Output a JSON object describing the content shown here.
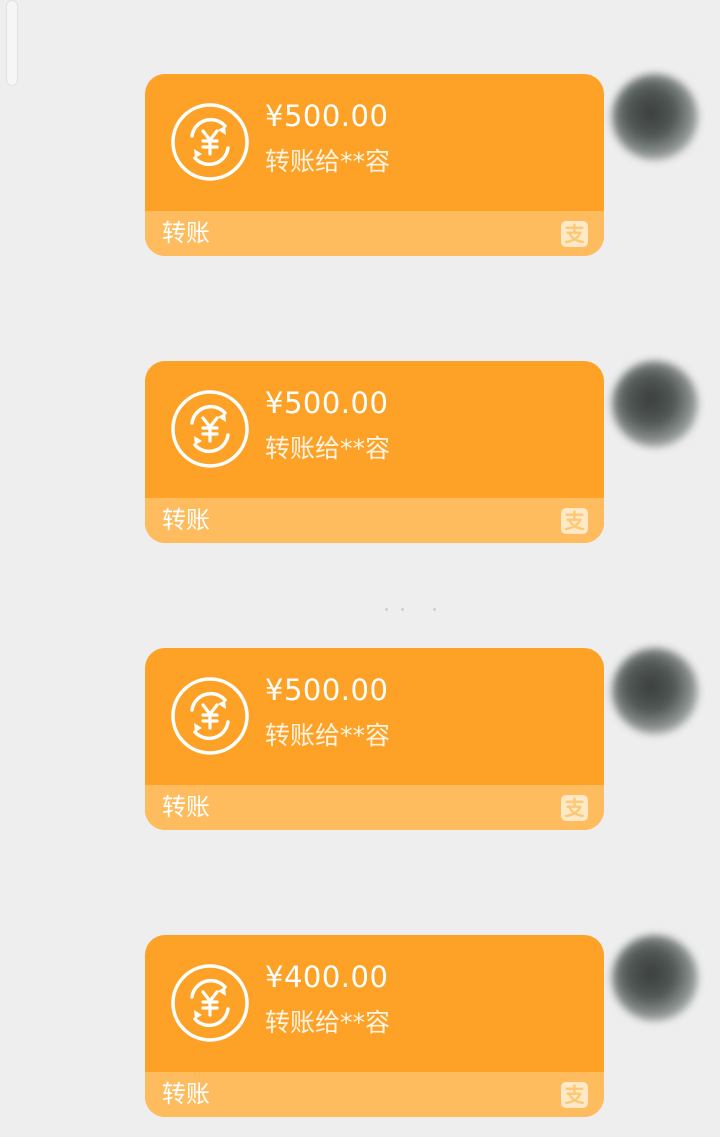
{
  "chat": {
    "messages": [
      {
        "amount": "¥500.00",
        "recipient": "转账给**容",
        "footer_label": "转账",
        "brand_icon_glyph": "支"
      },
      {
        "amount": "¥500.00",
        "recipient": "转账给**容",
        "footer_label": "转账",
        "brand_icon_glyph": "支"
      },
      {
        "amount": "¥500.00",
        "recipient": "转账给**容",
        "footer_label": "转账",
        "brand_icon_glyph": "支"
      },
      {
        "amount": "¥400.00",
        "recipient": "转账给**容",
        "footer_label": "转账",
        "brand_icon_glyph": "支"
      }
    ]
  },
  "colors": {
    "background": "#eeeeee",
    "bubble": "#fda226",
    "bubble_footer": "#ffbc5f",
    "text": "#ffffff"
  },
  "icons": {
    "transfer": "yuan-transfer-icon",
    "brand": "alipay-logo-icon",
    "avatar": "avatar"
  }
}
